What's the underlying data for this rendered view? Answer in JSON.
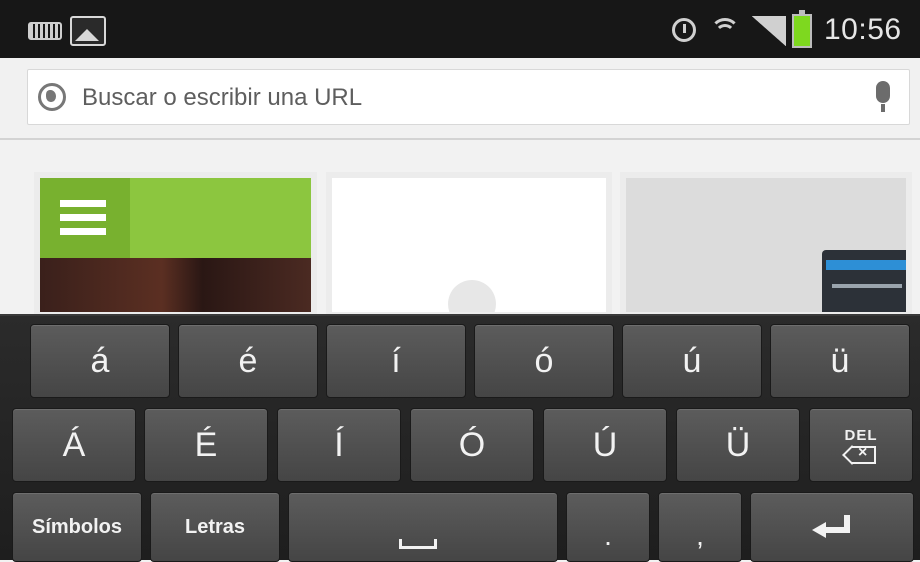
{
  "status_bar": {
    "time": "10:56",
    "battery_color": "#7ed81f",
    "icons": [
      "keyboard-icon",
      "image-icon",
      "alarm-icon",
      "wifi-icon",
      "signal-icon",
      "battery-icon"
    ]
  },
  "url_bar": {
    "placeholder": "Buscar o escribir una URL",
    "value": ""
  },
  "keyboard": {
    "row1": [
      "á",
      "é",
      "í",
      "ó",
      "ú",
      "ü"
    ],
    "row2": [
      "Á",
      "É",
      "Í",
      "Ó",
      "Ú",
      "Ü"
    ],
    "del_label": "DEL",
    "symbols_label": "Símbolos",
    "letters_label": "Letras",
    "period": ".",
    "comma": ","
  }
}
